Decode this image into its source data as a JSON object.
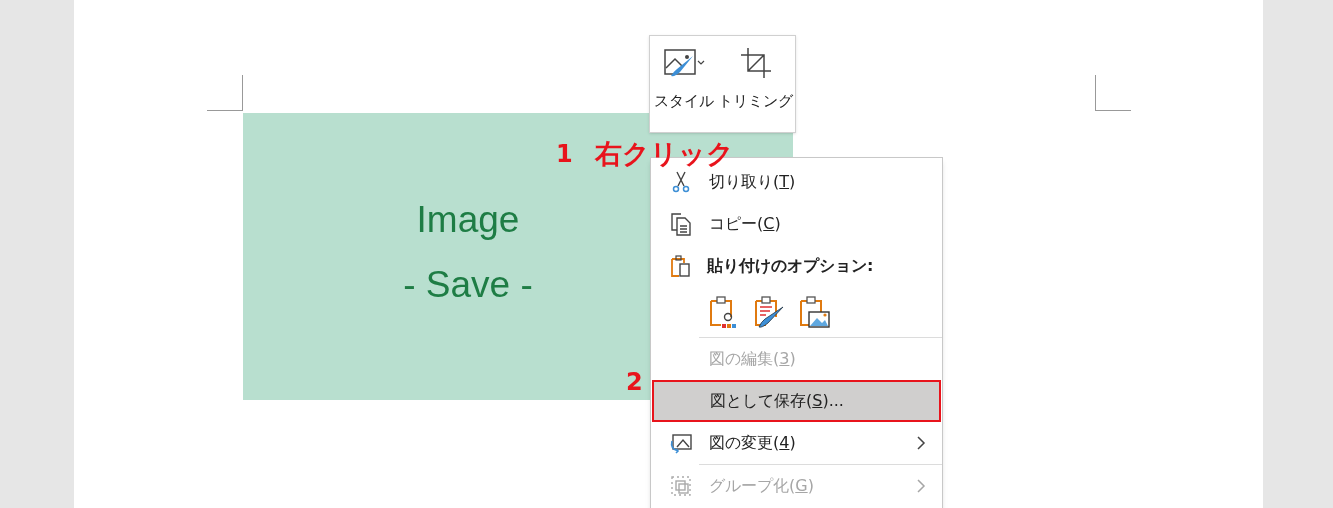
{
  "mini_toolbar": [
    {
      "label": "スタイル",
      "dropdown": true
    },
    {
      "label": "トリミング",
      "dropdown": false
    }
  ],
  "image": {
    "line_1": "Image",
    "line_2": "- Save -"
  },
  "annotations": [
    {
      "number": "1",
      "text": "右クリック"
    },
    {
      "number": "2"
    }
  ],
  "context_menu": [
    {
      "kind": "item",
      "before": "切り取り(",
      "key": "T",
      "after": ")",
      "disabled": false,
      "submenu": false,
      "selected": false
    },
    {
      "kind": "item",
      "before": "コピー(",
      "key": "C",
      "after": ")",
      "disabled": false,
      "submenu": false,
      "selected": false
    },
    {
      "kind": "header",
      "label": "貼り付けのオプション:"
    },
    {
      "kind": "paste-options"
    },
    {
      "kind": "item",
      "before": "図の編集(",
      "key": "3",
      "after": ")",
      "disabled": true,
      "submenu": false,
      "selected": false
    },
    {
      "kind": "item",
      "before": "図として保存(",
      "key": "S",
      "after": ")...",
      "disabled": false,
      "submenu": false,
      "selected": true
    },
    {
      "kind": "item",
      "before": "図の変更(",
      "key": "4",
      "after": ")",
      "disabled": false,
      "submenu": true,
      "selected": false
    },
    {
      "kind": "item",
      "before": "グループ化(",
      "key": "G",
      "after": ")",
      "disabled": true,
      "submenu": true,
      "selected": false
    }
  ]
}
